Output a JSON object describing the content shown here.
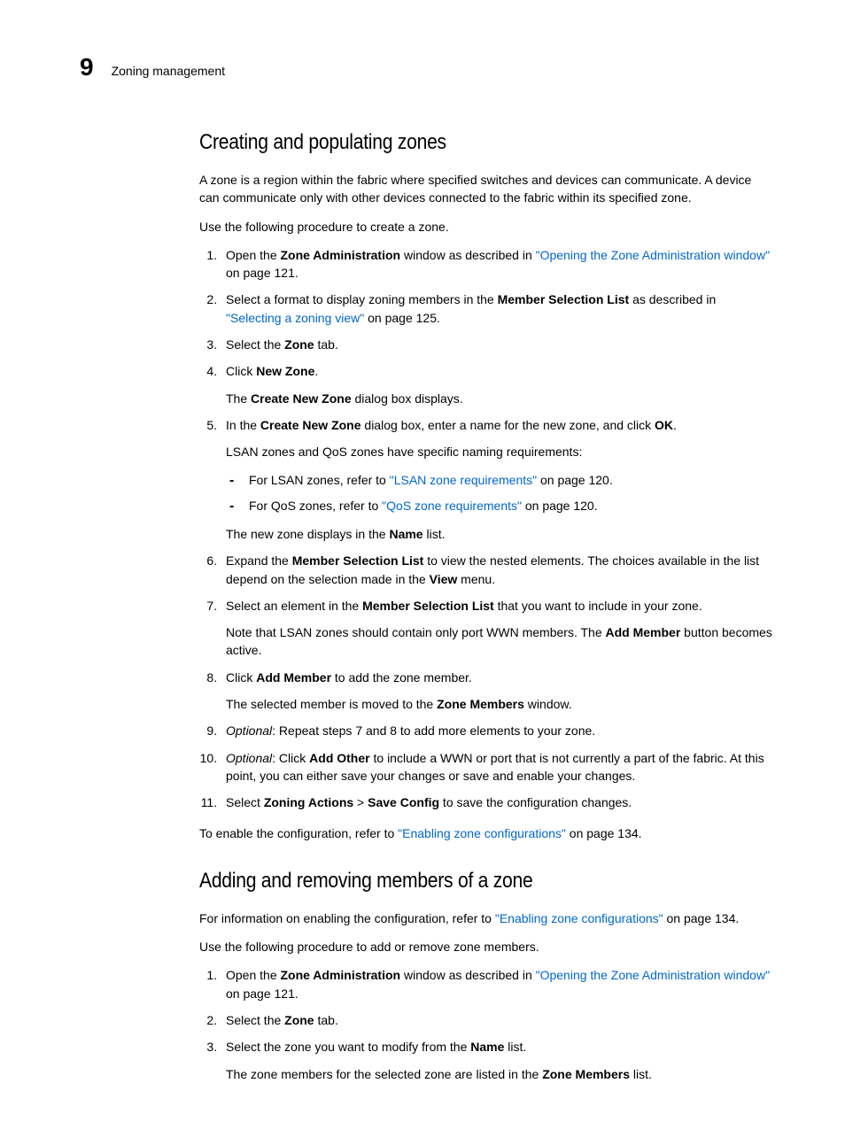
{
  "header": {
    "chapter": "9",
    "title": "Zoning management"
  },
  "h1": "Creating and populating zones",
  "p1": "A zone is a region within the fabric where specified switches and devices can communicate. A device can communicate only with other devices connected to the fabric within its specified zone.",
  "p2": "Use the following procedure to create a zone.",
  "s1": {
    "a": "Open the ",
    "b": "Zone Administration",
    "c": " window as described in ",
    "link": "\"Opening the Zone Administration window\"",
    "d": " on page 121."
  },
  "s2": {
    "a": "Select a format to display zoning members in the ",
    "b": "Member Selection List",
    "c": " as described in ",
    "link": "\"Selecting a zoning view\"",
    "d": " on page 125."
  },
  "s3": {
    "a": "Select the ",
    "b": "Zone",
    "c": " tab."
  },
  "s4": {
    "a": "Click ",
    "b": "New Zone",
    "c": ".",
    "sub_a": "The ",
    "sub_b": "Create New Zone",
    "sub_c": " dialog box displays."
  },
  "s5": {
    "a": "In the ",
    "b": "Create New Zone",
    "c": " dialog box, enter a name for the new zone, and click ",
    "d": "OK",
    "e": ".",
    "sub1": "LSAN zones and QoS zones have specific naming requirements:",
    "li1_a": "For LSAN zones, refer to ",
    "li1_link": "\"LSAN zone requirements\"",
    "li1_b": " on page 120.",
    "li2_a": "For QoS zones, refer to ",
    "li2_link": "\"QoS zone requirements\"",
    "li2_b": " on page 120.",
    "sub3_a": "The new zone displays in the ",
    "sub3_b": "Name",
    "sub3_c": " list."
  },
  "s6": {
    "a": "Expand the ",
    "b": "Member Selection List",
    "c": " to view the nested elements. The choices available in the list depend on the selection made in the ",
    "d": "View",
    "e": " menu."
  },
  "s7": {
    "a": "Select an element in the ",
    "b": "Member Selection List",
    "c": " that you want to include in your zone.",
    "sub_a": "Note that LSAN zones should contain only port WWN members. The ",
    "sub_b": "Add Member",
    "sub_c": " button becomes active."
  },
  "s8": {
    "a": "Click ",
    "b": "Add Member",
    "c": " to add the zone member.",
    "sub_a": "The selected member is moved to the ",
    "sub_b": "Zone Members",
    "sub_c": " window."
  },
  "s9": {
    "a": "Optional",
    "b": ": Repeat steps 7 and 8 to add more elements to your zone."
  },
  "s10": {
    "a": "Optional",
    "b": ": Click ",
    "c": "Add Other",
    "d": " to include a WWN or port that is not currently a part of the fabric. At this point, you can either save your changes or save and enable your changes."
  },
  "s11": {
    "a": "Select ",
    "b": "Zoning Actions",
    "c": " > ",
    "d": "Save Config",
    "e": " to save the configuration changes."
  },
  "p3": {
    "a": "To enable the configuration, refer to ",
    "link": "\"Enabling zone configurations\"",
    "b": " on page 134."
  },
  "h2": "Adding and removing members of a zone",
  "p4": {
    "a": "For information on enabling the configuration, refer to ",
    "link": "\"Enabling zone configurations\"",
    "b": " on page 134."
  },
  "p5": "Use the following procedure to add or remove zone members.",
  "t1": {
    "a": "Open the ",
    "b": "Zone Administration",
    "c": " window as described in ",
    "link": "\"Opening the Zone Administration window\"",
    "d": " on page 121."
  },
  "t2": {
    "a": "Select the ",
    "b": "Zone",
    "c": " tab."
  },
  "t3": {
    "a": "Select the zone you want to modify from the ",
    "b": "Name",
    "c": " list.",
    "sub_a": "The zone members for the selected zone are listed in the ",
    "sub_b": "Zone Members",
    "sub_c": " list."
  }
}
